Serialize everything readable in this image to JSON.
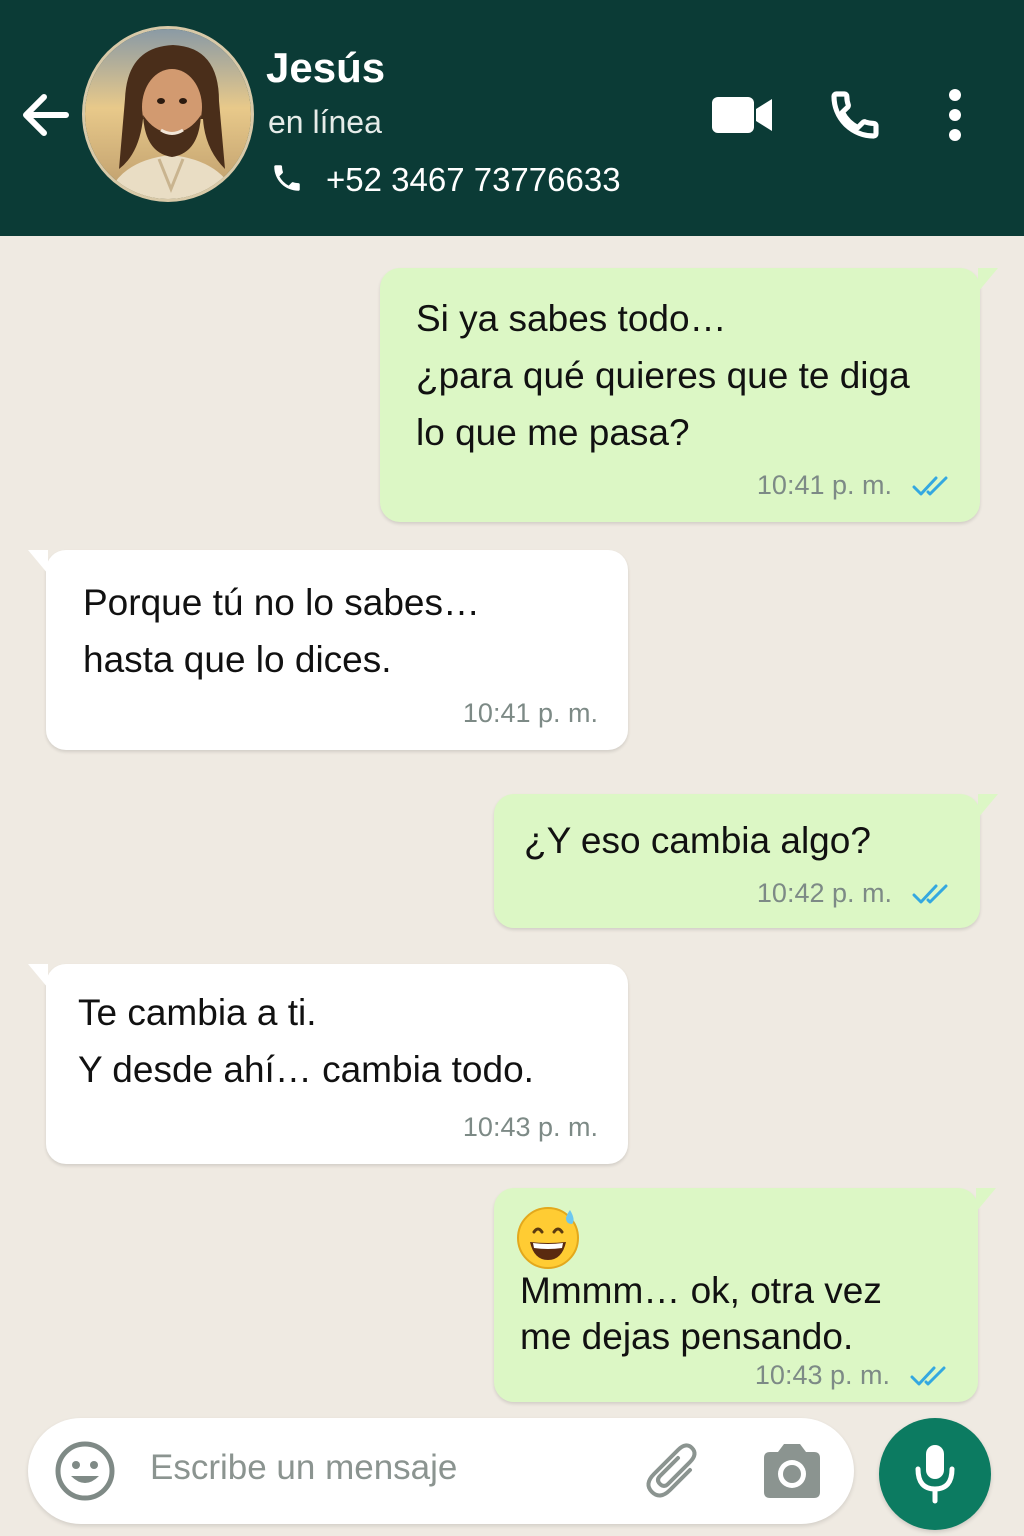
{
  "header": {
    "contact_name": "Jesús",
    "status": "en línea",
    "phone": "+52 3467 73776633",
    "icons": [
      "back-arrow-icon",
      "video-call-icon",
      "phone-call-icon",
      "more-options-icon"
    ],
    "background_color": "#0b3b36"
  },
  "messages": [
    {
      "direction": "outgoing",
      "lines": [
        "Si ya sabes todo…",
        "¿para qué quieres que te diga",
        "lo que me pasa?"
      ],
      "time": "10:41 p. m.",
      "read": true
    },
    {
      "direction": "incoming",
      "lines": [
        "Porque tú no lo sabes…",
        "hasta que lo dices."
      ],
      "time": "10:41 p. m."
    },
    {
      "direction": "outgoing",
      "lines": [
        "¿Y eso cambia algo?"
      ],
      "time": "10:42 p. m.",
      "read": true
    },
    {
      "direction": "incoming",
      "lines": [
        "Te cambia a ti.",
        "Y desde ahí… cambia todo."
      ],
      "time": "10:43 p. m."
    },
    {
      "direction": "outgoing",
      "emoji": "grinning-face-with-sweat-icon",
      "lines": [
        "Mmmm… ok, otra vez",
        "me dejas pensando."
      ],
      "time": "10:43 p. m.",
      "read": true
    }
  ],
  "input": {
    "placeholder": "Escribe un mensaje",
    "icons": [
      "emoji-icon",
      "paperclip-icon",
      "camera-icon",
      "microphone-icon"
    ]
  },
  "colors": {
    "outgoing_bubble": "#dcf7c5",
    "incoming_bubble": "#ffffff",
    "chat_background": "#efeae2",
    "read_ticks": "#34a8e0",
    "mic_button": "#0c7b61"
  }
}
